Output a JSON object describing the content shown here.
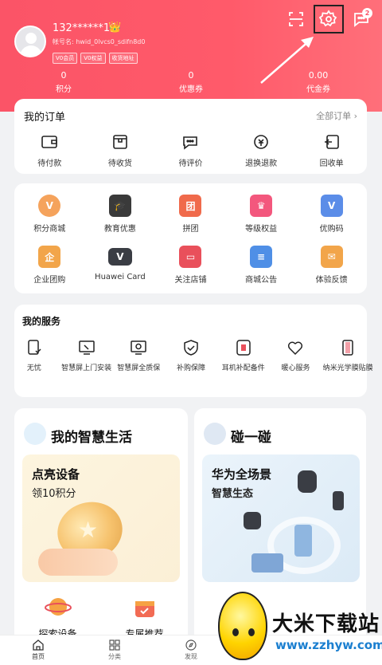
{
  "profile": {
    "username": "132******16",
    "account": "帐号名: hwid_0lvcs0_sdifn8d0",
    "tags": [
      "V0会员",
      "V0权益",
      "收货地址"
    ]
  },
  "header": {
    "message_badge": "2"
  },
  "stats": [
    {
      "value": "0",
      "label": "积分"
    },
    {
      "value": "0",
      "label": "优惠券"
    },
    {
      "value": "0.00",
      "label": "代金券"
    }
  ],
  "orders": {
    "title": "我的订单",
    "all_label": "全部订单",
    "items": [
      {
        "label": "待付款",
        "icon": "wallet-icon"
      },
      {
        "label": "待收货",
        "icon": "package-icon"
      },
      {
        "label": "待评价",
        "icon": "comment-icon"
      },
      {
        "label": "退换退款",
        "icon": "refund-icon"
      },
      {
        "label": "回收单",
        "icon": "recycle-icon"
      }
    ]
  },
  "perks": {
    "row1": [
      {
        "label": "积分商城",
        "icon": "points-mall-icon",
        "color": "#f5a35c"
      },
      {
        "label": "教育优惠",
        "icon": "graduation-cap-icon",
        "color": "#3a3a3a"
      },
      {
        "label": "拼团",
        "icon": "group-buy-icon",
        "color": "#f06a4b"
      },
      {
        "label": "等级权益",
        "icon": "crown-icon",
        "color": "#f3577d"
      },
      {
        "label": "优购码",
        "icon": "coupon-code-icon",
        "color": "#5b8de8"
      }
    ],
    "row2": [
      {
        "label": "企业团购",
        "icon": "enterprise-icon",
        "color": "#f2a54a"
      },
      {
        "label": "Huawei Card",
        "icon": "huawei-card-icon",
        "color": "#3a3d44"
      },
      {
        "label": "关注店铺",
        "icon": "store-icon",
        "color": "#e9505b"
      },
      {
        "label": "商城公告",
        "icon": "announcement-icon",
        "color": "#4f8fe6"
      },
      {
        "label": "体验反馈",
        "icon": "feedback-icon",
        "color": "#f2a54a"
      }
    ]
  },
  "services": {
    "title": "我的服务",
    "items": [
      {
        "label": "无忧",
        "icon": "worry-free-icon"
      },
      {
        "label": "智慧屏上门安装",
        "icon": "tv-install-icon"
      },
      {
        "label": "智慧屏全质保",
        "icon": "tv-warranty-icon"
      },
      {
        "label": "补购保障",
        "icon": "shield-check-icon"
      },
      {
        "label": "耳机补配备件",
        "icon": "earphone-parts-icon"
      },
      {
        "label": "暖心服务",
        "icon": "heart-icon"
      },
      {
        "label": "纳米光学膜贴膜",
        "icon": "screen-film-icon"
      }
    ]
  },
  "life": {
    "title": "我的智慧生活",
    "promo_title": "点亮设备",
    "promo_sub": "领10积分",
    "items": [
      {
        "label": "探索设备",
        "icon": "planet-icon"
      },
      {
        "label": "专属推荐",
        "icon": "gift-icon"
      }
    ]
  },
  "touch": {
    "title": "碰一碰",
    "promo_title": "华为全场景",
    "promo_sub": "智慧生态"
  },
  "tabbar": [
    {
      "label": "首页",
      "icon": "home-icon"
    },
    {
      "label": "分类",
      "icon": "category-icon"
    },
    {
      "label": "发现",
      "icon": "compass-icon"
    }
  ],
  "watermark": {
    "title": "大米下载站",
    "url": "www.zzhyw.com"
  },
  "colors": {
    "brand": "#fb5467",
    "accent_blue": "#1b7fd0"
  }
}
